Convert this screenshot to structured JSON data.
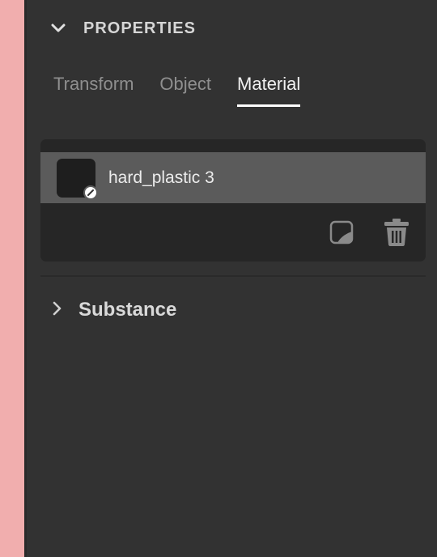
{
  "properties": {
    "title": "PROPERTIES"
  },
  "tabs": [
    {
      "label": "Transform",
      "active": false
    },
    {
      "label": "Object",
      "active": false
    },
    {
      "label": "Material",
      "active": true
    }
  ],
  "material": {
    "name": "hard_plastic 3",
    "swatch_color": "#1e1e1e"
  },
  "substance": {
    "title": "Substance"
  },
  "colors": {
    "panel_bg": "#323232",
    "card_bg": "#262626",
    "selected_row": "#5b5b5b",
    "canvas": "#f1aeae"
  }
}
